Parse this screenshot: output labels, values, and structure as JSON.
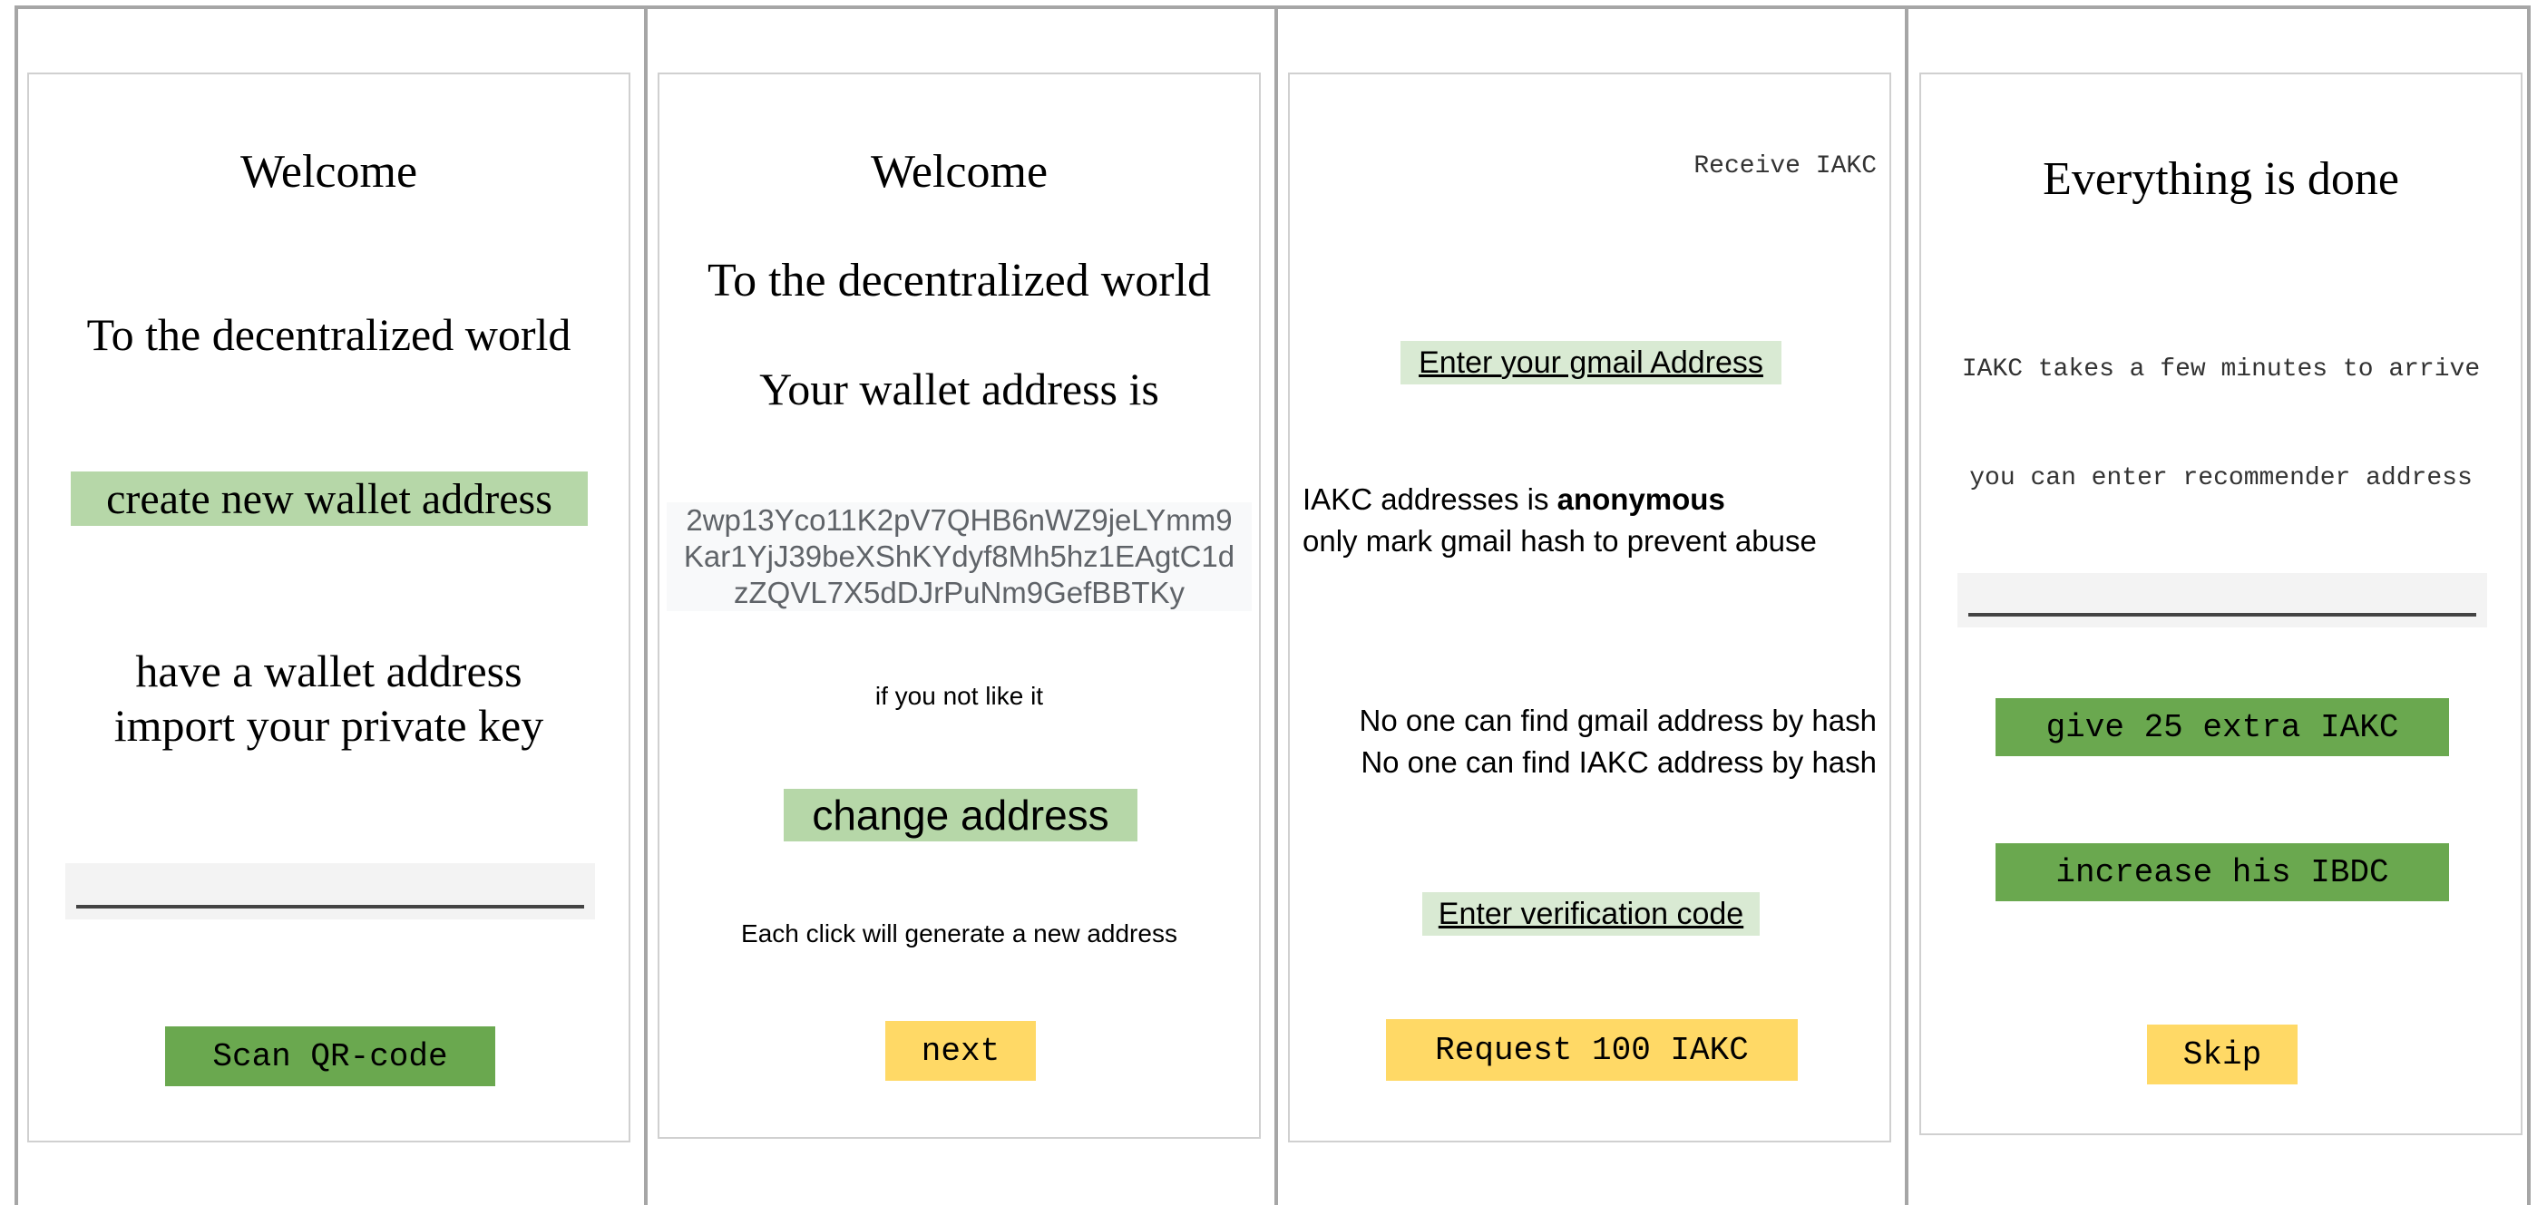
{
  "screens": [
    {
      "title": "Welcome",
      "subtitle": "To the decentralized world",
      "create_button": "create  new wallet address",
      "import_line1": "have a wallet address",
      "import_line2": "import your private key",
      "private_key_value": "",
      "scan_button": "Scan  QR-code"
    },
    {
      "title": "Welcome",
      "subtitle": "To the decentralized world",
      "address_heading": "Your wallet address is",
      "address_line1": "2wp13Yco11K2pV7QHB6nWZ9jeLYmm9",
      "address_line2": "Kar1YjJ39beXShKYdyf8Mh5hz1EAgtC1d",
      "address_line3": "zZQVL7X5dDJrPuNm9GefBBTKy",
      "not_like_text": "if you not like it",
      "change_button": "change address",
      "hint_text": "Each click will generate a new address",
      "next_button": "next"
    },
    {
      "title": "Receive IAKC",
      "gmail_link": "Enter your gmail Address",
      "anon_prefix": "IAKC addresses is ",
      "anon_bold": "anonymous",
      "anon_line2": "only mark gmail hash to prevent abuse",
      "privacy_line1": "No one can find gmail address by hash",
      "privacy_line2": "No one can find IAKC address by hash",
      "verify_link": "Enter verification code",
      "request_button": "Request 100 IAKC"
    },
    {
      "title": "Everything is done",
      "arrive_text": "IAKC takes a few minutes to arrive",
      "recommender_text": "you can enter recommender address",
      "recommender_value": "",
      "extra_button": "give 25 extra IAKC",
      "increase_button": "increase his IBDC",
      "skip_button": "Skip"
    }
  ]
}
